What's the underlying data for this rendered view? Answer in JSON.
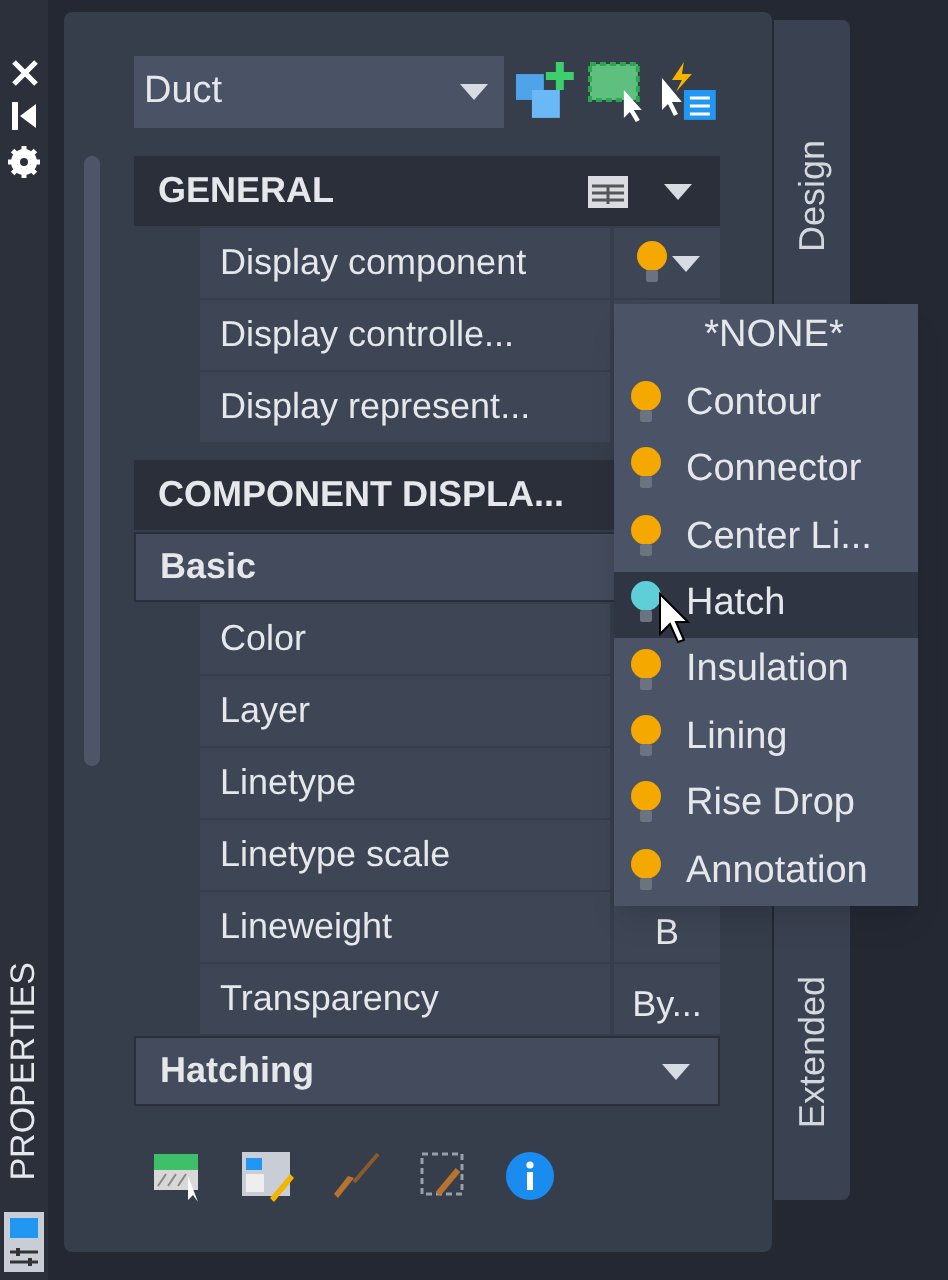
{
  "side_strip": {
    "title": "PROPERTIES"
  },
  "object_select": {
    "value": "Duct"
  },
  "sections": [
    {
      "title": "GENERAL",
      "kind": "category",
      "expanded": true,
      "rows": [
        {
          "label": "Display component",
          "kind": "bulb",
          "color": "#f5a800"
        },
        {
          "label": "Display  controlle..."
        },
        {
          "label": "Display  represent..."
        }
      ]
    },
    {
      "title": "COMPONENT  DISPLA...",
      "kind": "category"
    },
    {
      "title": "Basic",
      "kind": "group",
      "rows": [
        {
          "label": "Color"
        },
        {
          "label": "Layer"
        },
        {
          "label": "Linetype"
        },
        {
          "label": "Linetype scale"
        },
        {
          "label": "Lineweight",
          "value": "B"
        },
        {
          "label": "Transparency",
          "value": "By..."
        }
      ]
    },
    {
      "title": "Hatching",
      "kind": "group",
      "expanded": true
    }
  ],
  "dropdown": {
    "items": [
      {
        "label": "*NONE*",
        "selected": false
      },
      {
        "label": "Contour",
        "color": "#f5a800",
        "selected": false
      },
      {
        "label": "Connector",
        "color": "#f5a800",
        "selected": false
      },
      {
        "label": "Center  Li...",
        "color": "#f5a800",
        "selected": false
      },
      {
        "label": "Hatch",
        "color": "#5ecfd6",
        "selected": true
      },
      {
        "label": "Insulation",
        "color": "#f5a800",
        "selected": false
      },
      {
        "label": "Lining",
        "color": "#f5a800",
        "selected": false
      },
      {
        "label": "Rise Drop",
        "color": "#f5a800",
        "selected": false
      },
      {
        "label": "Annotation",
        "color": "#f5a800",
        "selected": false
      }
    ]
  },
  "side_tabs": [
    {
      "label": "Design"
    },
    {
      "label": "Extended"
    }
  ]
}
